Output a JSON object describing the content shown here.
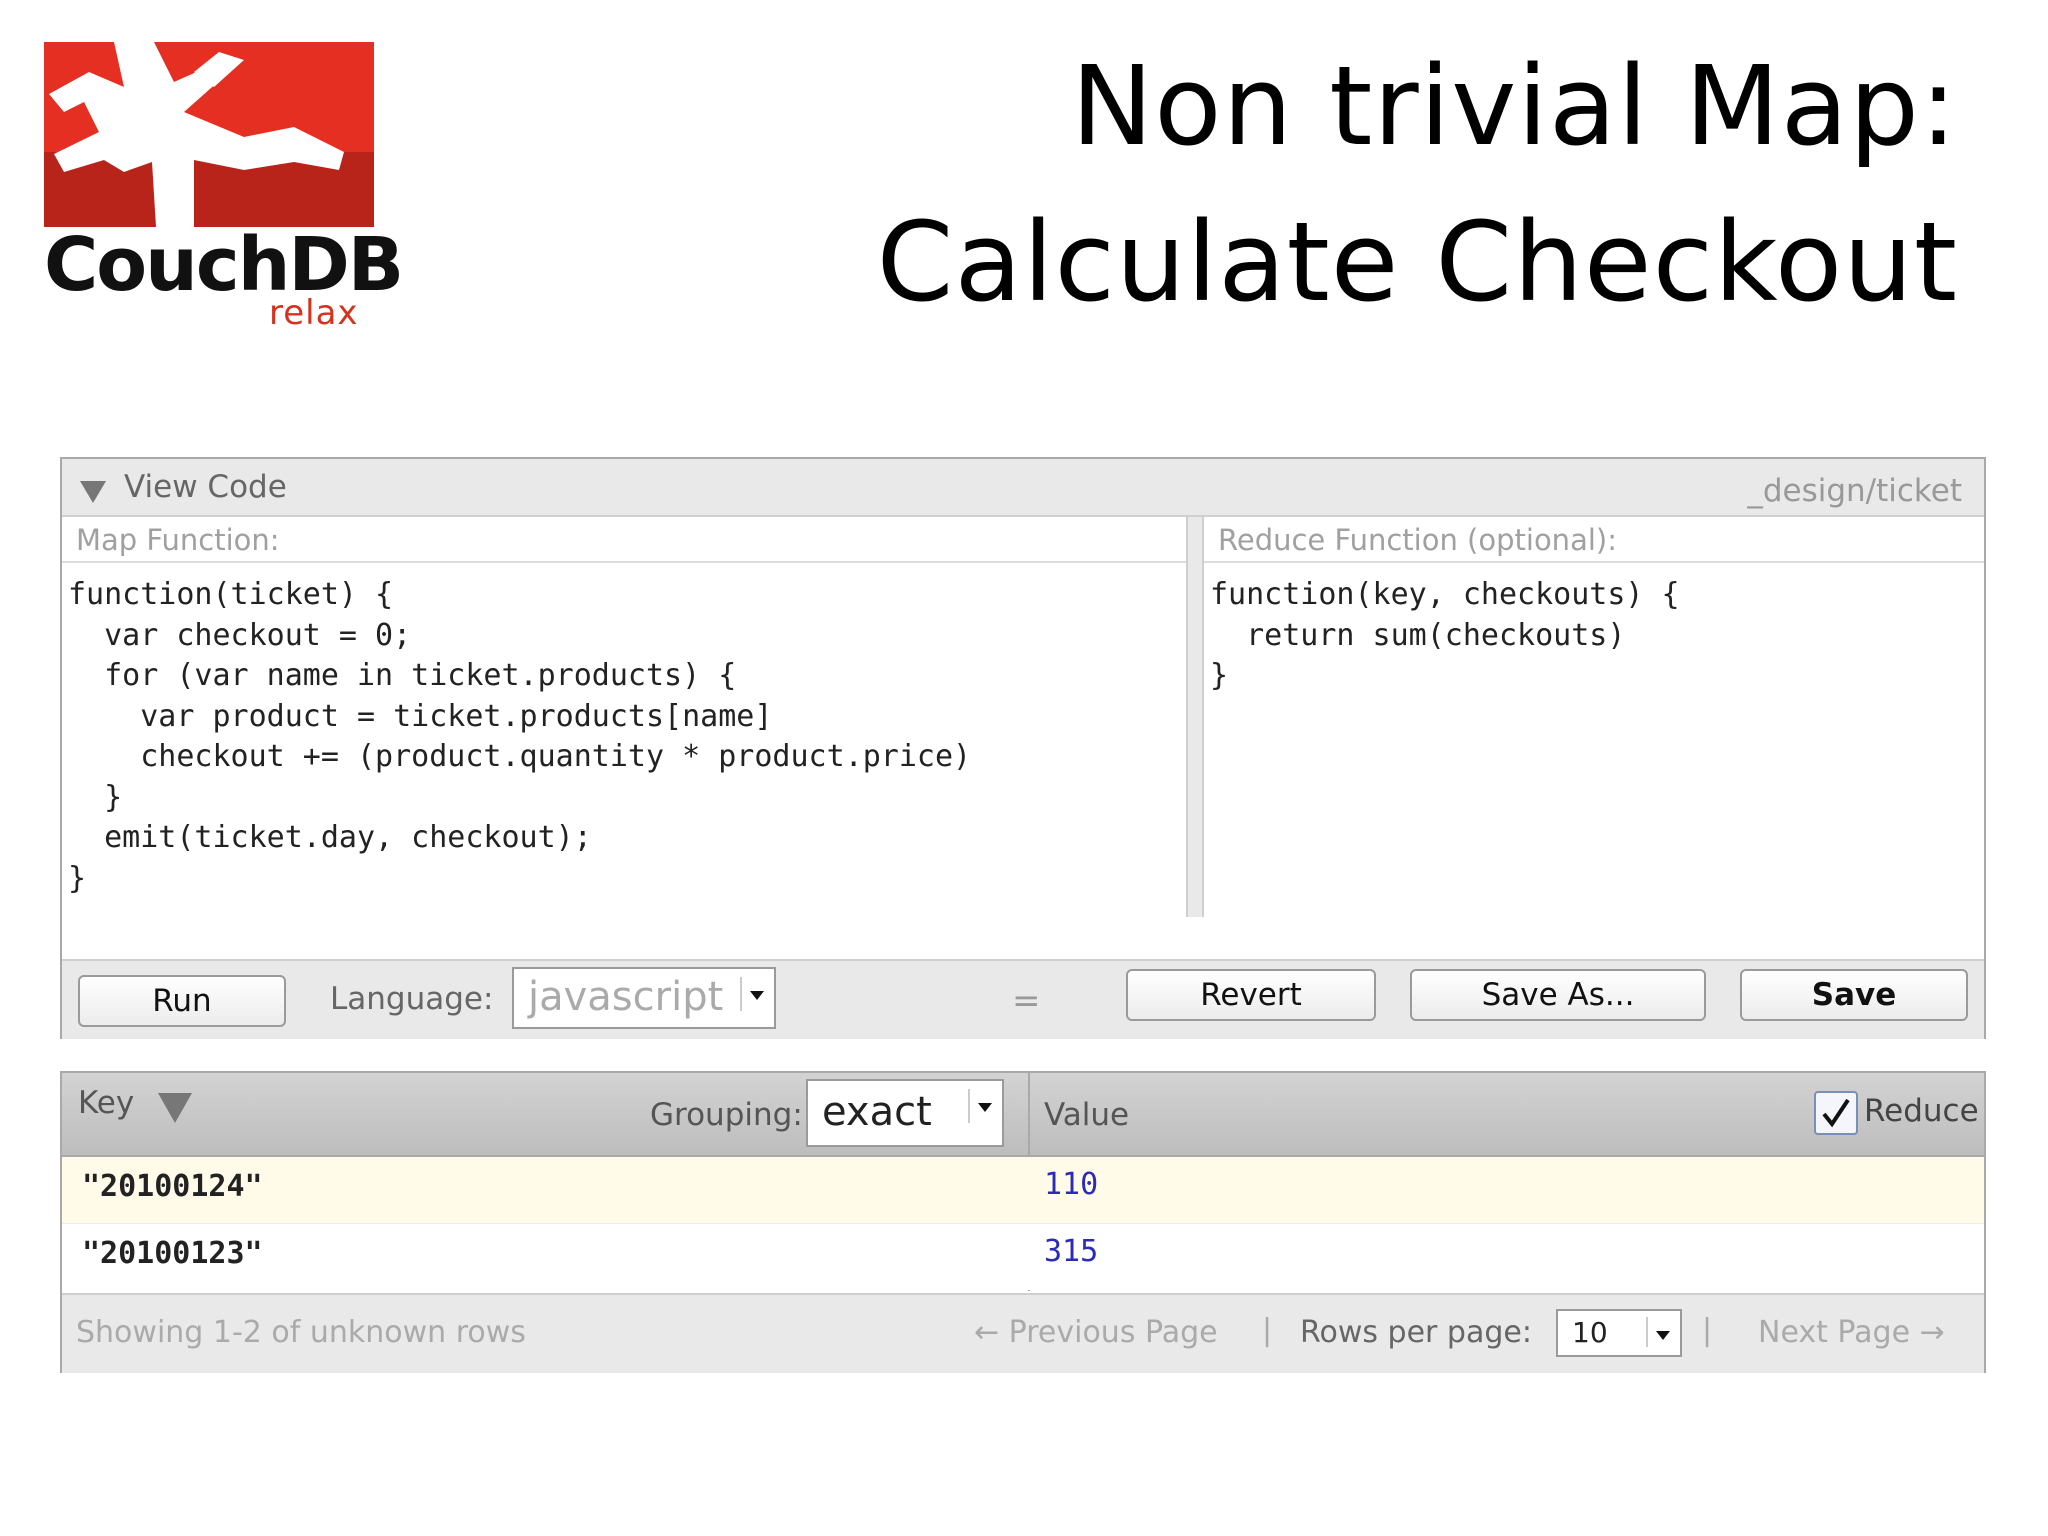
{
  "logo": {
    "name": "CouchDB",
    "tagline": "relax",
    "icon": "couchdb-logo"
  },
  "title": {
    "line1": "Non trivial Map:",
    "line2": "Calculate Checkout"
  },
  "view_code": {
    "header_label": "View Code",
    "design_doc": "_design/ticket",
    "map_label": "Map Function:",
    "reduce_label": "Reduce Function (optional):",
    "map_code": "function(ticket) {\n  var checkout = 0;\n  for (var name in ticket.products) {\n    var product = ticket.products[name]\n    checkout += (product.quantity * product.price)\n  }\n  emit(ticket.day, checkout);\n}",
    "reduce_code": "function(key, checkouts) {\n  return sum(checkouts)\n}"
  },
  "toolbar": {
    "run_label": "Run",
    "language_label": "Language:",
    "language_value": "javascript",
    "grip": "=",
    "revert_label": "Revert",
    "save_as_label": "Save As...",
    "save_label": "Save"
  },
  "results": {
    "key_header": "Key",
    "grouping_label": "Grouping:",
    "grouping_value": "exact",
    "value_header": "Value",
    "reduce_label": "Reduce",
    "reduce_checked": true,
    "rows": [
      {
        "key": "\"20100124\"",
        "value": "110"
      },
      {
        "key": "\"20100123\"",
        "value": "315"
      }
    ]
  },
  "footer": {
    "showing": "Showing 1-2 of unknown rows",
    "prev_page": "← Previous Page",
    "separator": "|",
    "rows_per_page_label": "Rows per page:",
    "rows_per_page_value": "10",
    "next_page": "Next Page →"
  },
  "colors": {
    "logo_red": "#e42f22",
    "tagline_red": "#d4331f",
    "value_blue": "#2b2bb8",
    "row_highlight": "#fffbe8"
  }
}
